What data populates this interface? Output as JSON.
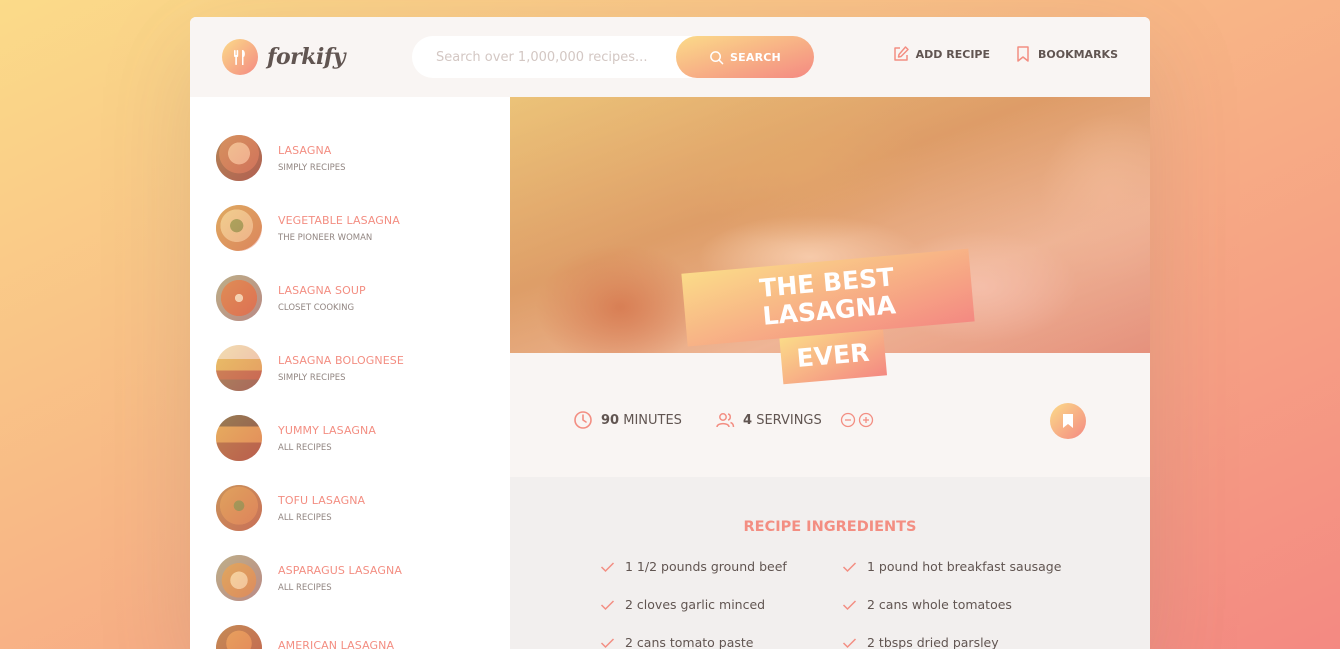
{
  "header": {
    "logo_text": "forkify",
    "search_placeholder": "Search over 1,000,000 recipes...",
    "search_button": "SEARCH",
    "nav": [
      {
        "label": "ADD RECIPE",
        "icon": "edit-icon"
      },
      {
        "label": "BOOKMARKS",
        "icon": "bookmark-icon"
      }
    ]
  },
  "results": [
    {
      "title": "LASAGNA",
      "publisher": "SIMPLY RECIPES"
    },
    {
      "title": "VEGETABLE LASAGNA",
      "publisher": "THE PIONEER WOMAN"
    },
    {
      "title": "LASAGNA SOUP",
      "publisher": "CLOSET COOKING"
    },
    {
      "title": "LASAGNA BOLOGNESE",
      "publisher": "SIMPLY RECIPES"
    },
    {
      "title": "YUMMY LASAGNA",
      "publisher": "ALL RECIPES"
    },
    {
      "title": "TOFU LASAGNA",
      "publisher": "ALL RECIPES"
    },
    {
      "title": "ASPARAGUS LASAGNA",
      "publisher": "ALL RECIPES"
    },
    {
      "title": "AMERICAN LASAGNA",
      "publisher": ""
    }
  ],
  "recipe": {
    "title_line1": "THE BEST LASAGNA",
    "title_line2": "EVER",
    "minutes": "90",
    "minutes_label": "MINUTES",
    "servings": "4",
    "servings_label": "SERVINGS",
    "ingredients_heading": "RECIPE INGREDIENTS",
    "ingredients": [
      "1 1/2 pounds ground beef",
      "1 pound hot breakfast sausage",
      "2 cloves garlic minced",
      "2 cans whole tomatoes",
      "2 cans tomato paste",
      "2 tbsps dried parsley"
    ]
  },
  "colors": {
    "accent": "#f38e82",
    "gradient_start": "#fbdb89",
    "gradient_end": "#f48982",
    "text": "#615551",
    "panel": "#f9f5f3"
  }
}
